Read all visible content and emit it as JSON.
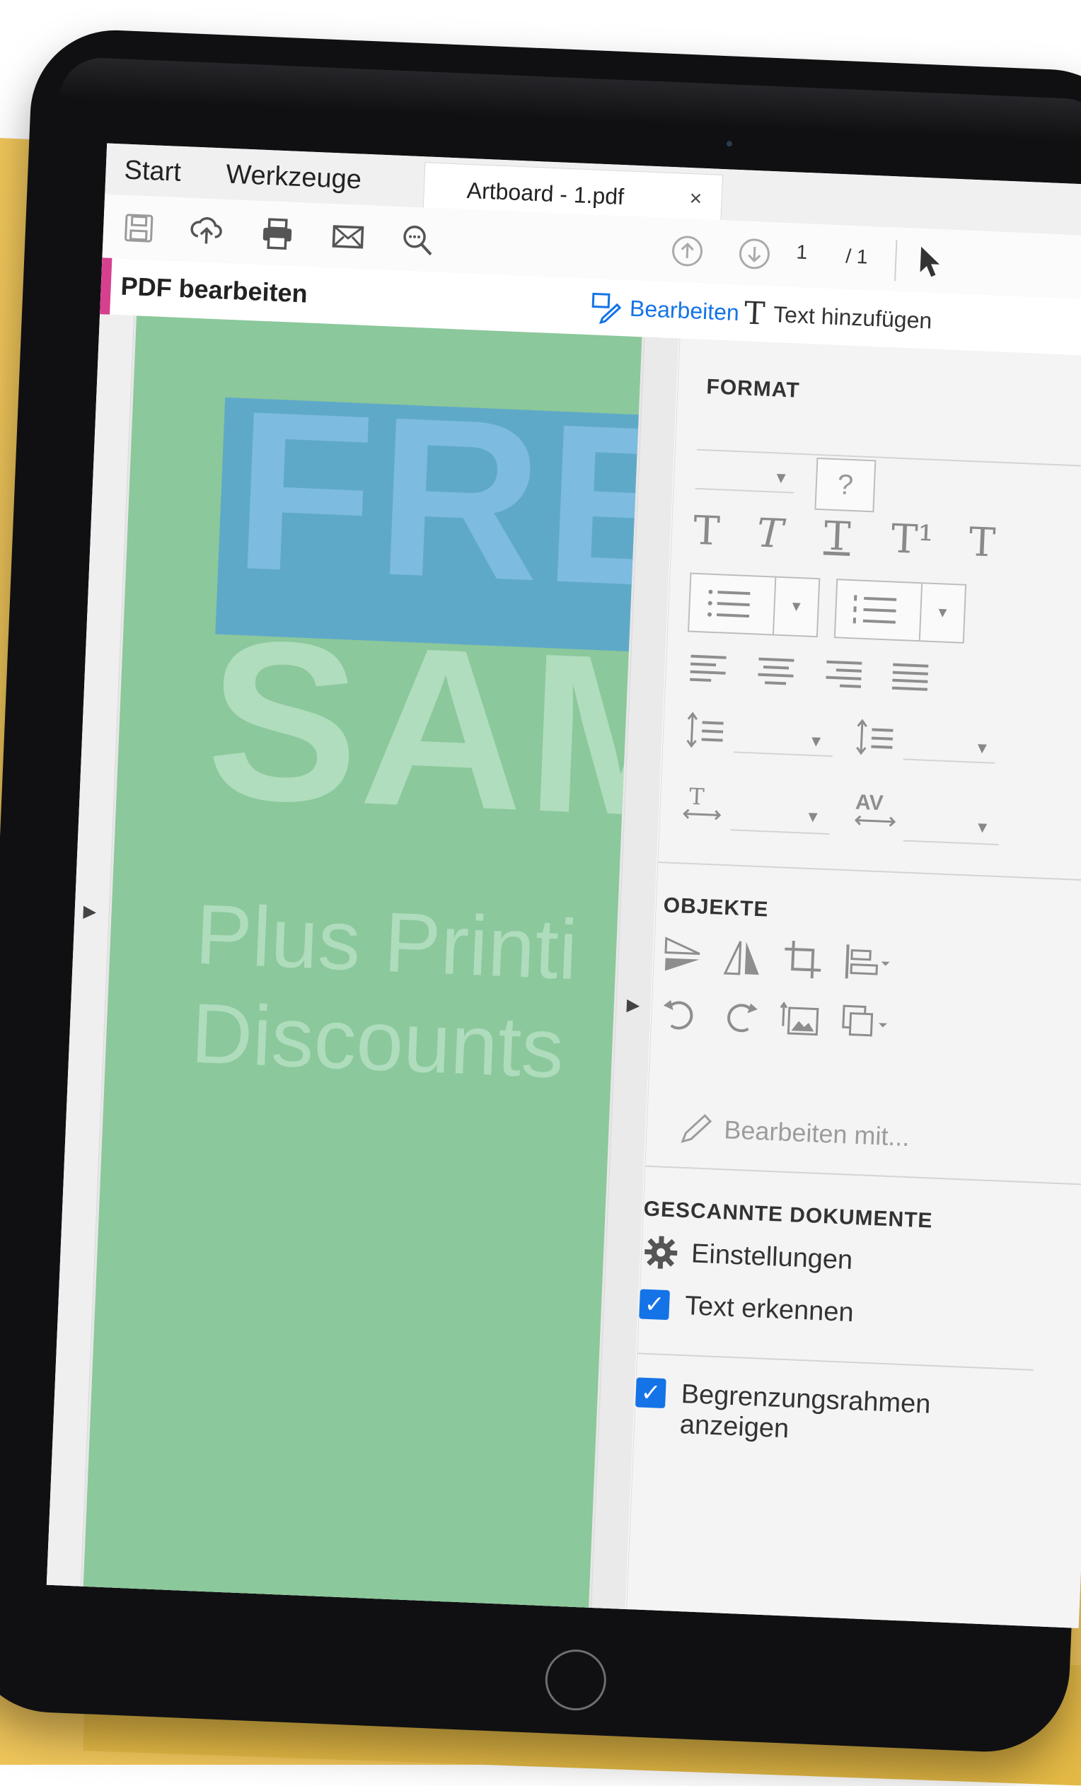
{
  "tabs": {
    "start": "Start",
    "werkzeuge": "Werkzeuge",
    "document": "Artboard - 1.pdf",
    "close": "×"
  },
  "toolbar": {
    "icons": [
      "save-icon",
      "upload-icon",
      "print-icon",
      "mail-icon",
      "zoom-search-icon",
      "page-up-icon",
      "page-down-icon",
      "select-cursor-icon"
    ],
    "page_current": "1",
    "page_total": "/ 1"
  },
  "edit_bar": {
    "title": "PDF bearbeiten",
    "edit_label": "Bearbeiten",
    "add_text_label": "Text hinzufügen",
    "accent_color": "#d6408f",
    "link_color": "#1473e6"
  },
  "document": {
    "headline_1": "FRE",
    "headline_2": "SAM",
    "subline_1": "Plus Printi",
    "subline_2": "Discounts",
    "background_color": "#8bc89b"
  },
  "panel": {
    "format_title": "FORMAT",
    "help_glyph": "?",
    "text_styles": [
      "T",
      "T",
      "T",
      "T¹",
      "T"
    ],
    "objects_title": "OBJEKTE",
    "edit_with": "Bearbeiten mit...",
    "scanned_title": "GESCANNTE DOKUMENTE",
    "settings_label": "Einstellungen",
    "recognize_text_label": "Text erkennen",
    "recognize_text_checked": true,
    "bounding_box_label_1": "Begrenzungsrahmen",
    "bounding_box_label_2": "anzeigen",
    "bounding_box_checked": true,
    "spacing_label": "AV"
  }
}
